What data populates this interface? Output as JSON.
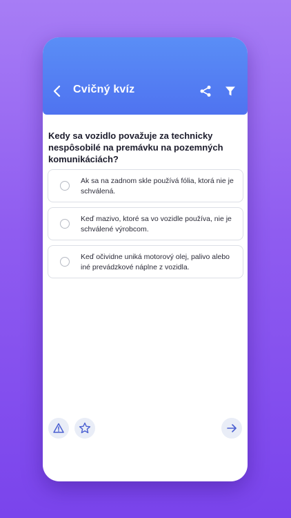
{
  "appbar": {
    "title": "Cvičný kvíz",
    "back_icon": "arrow-left-icon",
    "share_icon": "share-icon",
    "filter_icon": "filter-icon"
  },
  "quiz": {
    "question": "Kedy sa vozidlo považuje za technicky nespôsobilé na premávku na pozemných komunikáciách?",
    "options": [
      {
        "text": "Ak sa na zadnom skle používá fólia, ktorá nie je schválená."
      },
      {
        "text": "Keď mazivo, ktoré sa vo vozidle používa, nie je schválené výrobcom."
      },
      {
        "text": "Keď očividne uniká motorový olej, palivo alebo iné prevádzkové náplne z vozidla."
      }
    ]
  },
  "bottombar": {
    "report_icon": "warning-icon",
    "favorite_icon": "star-icon",
    "next_icon": "arrow-right-icon"
  },
  "colors": {
    "background": "#8f5cf0",
    "appbar": "#4f73f0",
    "accent": "#4a5fd1"
  }
}
